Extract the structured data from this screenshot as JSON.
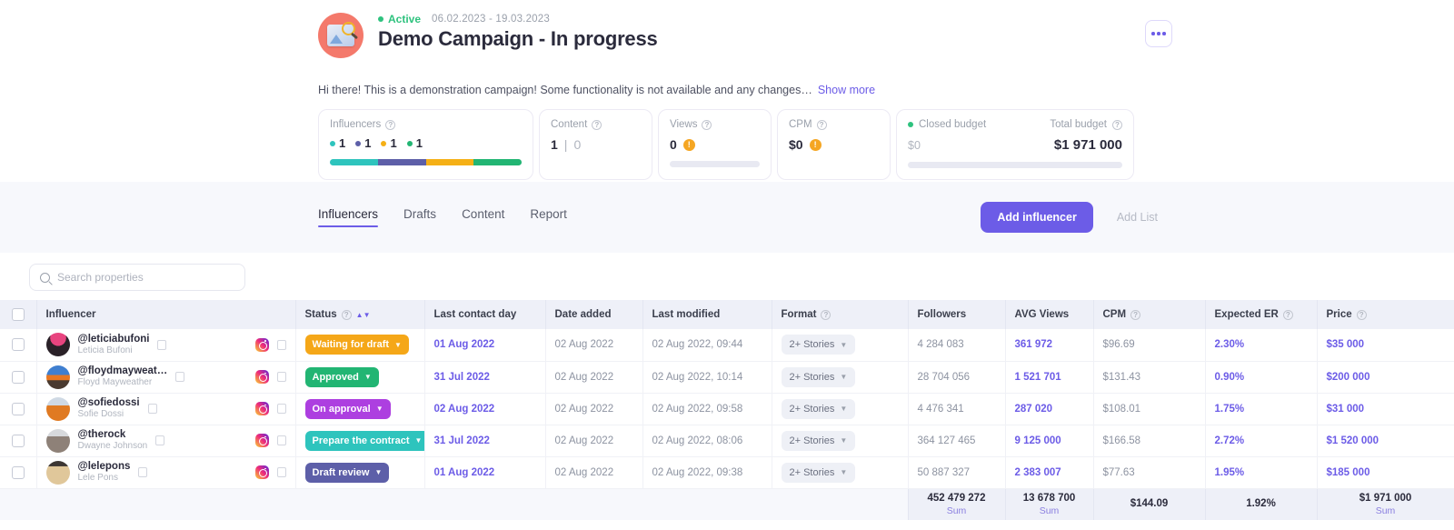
{
  "colors": {
    "accent": "#6c5ce7",
    "active_green": "#2ec27e",
    "seg_teal": "#2ec4bd",
    "seg_purple": "#5d5fa8",
    "seg_amber": "#f5b016",
    "seg_green": "#22b573",
    "warn_amber": "#f5a623"
  },
  "header": {
    "avatar_icon": "campaign-photo-icon",
    "status_label": "Active",
    "dates": "06.02.2023 - 19.03.2023",
    "title": "Demo Campaign - In progress",
    "description": "Hi there! This is a demonstration campaign! Some functionality is not available and any changes…",
    "show_more_label": "Show more",
    "menu_label": "more-options"
  },
  "stats": {
    "influencers": {
      "label": "Influencers",
      "legend": [
        {
          "value": "1",
          "color": "#2ec4bd"
        },
        {
          "value": "1",
          "color": "#5d5fa8"
        },
        {
          "value": "1",
          "color": "#f5b016"
        },
        {
          "value": "1",
          "color": "#22b573"
        }
      ],
      "segments": [
        {
          "color": "#2ec4bd",
          "pct": 25
        },
        {
          "color": "#5d5fa8",
          "pct": 25
        },
        {
          "color": "#f5b016",
          "pct": 25
        },
        {
          "color": "#22b573",
          "pct": 25
        }
      ]
    },
    "content": {
      "label": "Content",
      "value": "1",
      "separator": "|",
      "secondary": "0"
    },
    "views": {
      "label": "Views",
      "value": "0",
      "warn": "!"
    },
    "cpm": {
      "label": "CPM",
      "value": "$0",
      "warn": "!"
    },
    "budget": {
      "closed_label": "Closed budget",
      "total_label": "Total budget",
      "closed_value": "$0",
      "total_value": "$1 971 000"
    }
  },
  "tabs": [
    {
      "label": "Influencers",
      "active": true
    },
    {
      "label": "Drafts",
      "active": false
    },
    {
      "label": "Content",
      "active": false
    },
    {
      "label": "Report",
      "active": false
    }
  ],
  "actions": {
    "add_influencer": "Add influencer",
    "add_list": "Add List"
  },
  "search": {
    "placeholder": "Search properties",
    "value": "",
    "icon": "search-icon"
  },
  "table": {
    "columns": [
      {
        "key": "check",
        "label": ""
      },
      {
        "key": "influencer",
        "label": "Influencer",
        "help": false,
        "sort": false
      },
      {
        "key": "status",
        "label": "Status",
        "help": true,
        "sort": true
      },
      {
        "key": "last_contact_day",
        "label": "Last contact day",
        "help": false,
        "sort": false
      },
      {
        "key": "date_added",
        "label": "Date added",
        "help": false,
        "sort": false
      },
      {
        "key": "last_modified",
        "label": "Last modified",
        "help": false,
        "sort": false
      },
      {
        "key": "format",
        "label": "Format",
        "help": true,
        "sort": false
      },
      {
        "key": "followers",
        "label": "Followers",
        "help": false,
        "sort": false
      },
      {
        "key": "avg_views",
        "label": "AVG Views",
        "help": false,
        "sort": false
      },
      {
        "key": "cpm",
        "label": "CPM",
        "help": true,
        "sort": false
      },
      {
        "key": "expected_er",
        "label": "Expected ER",
        "help": true,
        "sort": false
      },
      {
        "key": "price",
        "label": "Price",
        "help": true,
        "sort": false
      }
    ],
    "rows": [
      {
        "handle": "@leticiabufoni",
        "name": "Leticia Bufoni",
        "avatar": "av1",
        "network": "instagram-icon",
        "status": {
          "label": "Waiting for draft",
          "color": "#f5a718"
        },
        "last_contact_day": "01 Aug 2022",
        "date_added": "02 Aug 2022",
        "last_modified": "02 Aug 2022, 09:44",
        "format": "2+ Stories",
        "followers": "4 284 083",
        "avg_views": "361 972",
        "cpm": "$96.69",
        "expected_er": "2.30%",
        "price": "$35 000"
      },
      {
        "handle": "@floydmayweat…",
        "name": "Floyd Mayweather",
        "avatar": "av2",
        "network": "instagram-icon",
        "status": {
          "label": "Approved",
          "color": "#22b573"
        },
        "last_contact_day": "31 Jul 2022",
        "date_added": "02 Aug 2022",
        "last_modified": "02 Aug 2022, 10:14",
        "format": "2+ Stories",
        "followers": "28 704 056",
        "avg_views": "1 521 701",
        "cpm": "$131.43",
        "expected_er": "0.90%",
        "price": "$200 000"
      },
      {
        "handle": "@sofiedossi",
        "name": "Sofie Dossi",
        "avatar": "av3",
        "network": "instagram-icon",
        "status": {
          "label": "On approval",
          "color": "#ad3fe0"
        },
        "last_contact_day": "02 Aug 2022",
        "date_added": "02 Aug 2022",
        "last_modified": "02 Aug 2022, 09:58",
        "format": "2+ Stories",
        "followers": "4 476 341",
        "avg_views": "287 020",
        "cpm": "$108.01",
        "expected_er": "1.75%",
        "price": "$31 000"
      },
      {
        "handle": "@therock",
        "name": "Dwayne Johnson",
        "avatar": "av4",
        "network": "instagram-icon",
        "status": {
          "label": "Prepare the contract",
          "color": "#2ec4bd"
        },
        "last_contact_day": "31 Jul 2022",
        "date_added": "02 Aug 2022",
        "last_modified": "02 Aug 2022, 08:06",
        "format": "2+ Stories",
        "followers": "364 127 465",
        "avg_views": "9 125 000",
        "cpm": "$166.58",
        "expected_er": "2.72%",
        "price": "$1 520 000"
      },
      {
        "handle": "@lelepons",
        "name": "Lele Pons",
        "avatar": "av5",
        "network": "instagram-icon",
        "status": {
          "label": "Draft review",
          "color": "#5d5fa8"
        },
        "last_contact_day": "01 Aug 2022",
        "date_added": "02 Aug 2022",
        "last_modified": "02 Aug 2022, 09:38",
        "format": "2+ Stories",
        "followers": "50 887 327",
        "avg_views": "2 383 007",
        "cpm": "$77.63",
        "expected_er": "1.95%",
        "price": "$185 000"
      }
    ],
    "footer": {
      "followers": {
        "value": "452 479 272",
        "label": "Sum"
      },
      "avg_views": {
        "value": "13 678 700",
        "label": "Sum"
      },
      "cpm": {
        "value": "$144.09",
        "label": ""
      },
      "expected_er": {
        "value": "1.92%",
        "label": ""
      },
      "price": {
        "value": "$1 971 000",
        "label": "Sum"
      }
    }
  }
}
